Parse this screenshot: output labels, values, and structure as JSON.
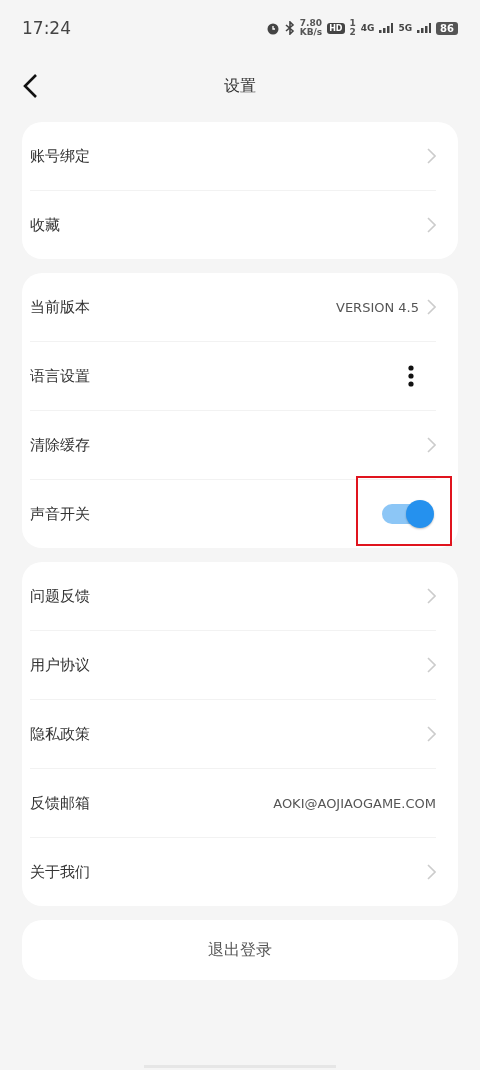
{
  "status_bar": {
    "time": "17:24",
    "speed": "7.80",
    "speed_unit": "KB/s",
    "hd": "HD",
    "sim": "1",
    "sim2": "2",
    "net1": "4G",
    "net2": "5G",
    "battery": "86"
  },
  "header": {
    "title": "设置"
  },
  "groups": [
    {
      "rows": [
        {
          "kind": "link",
          "label": "账号绑定"
        },
        {
          "kind": "link",
          "label": "收藏"
        }
      ]
    },
    {
      "rows": [
        {
          "kind": "link",
          "label": "当前版本",
          "value": "VERSION 4.5"
        },
        {
          "kind": "more",
          "label": "语言设置"
        },
        {
          "kind": "link",
          "label": "清除缓存"
        },
        {
          "kind": "switch",
          "label": "声音开关",
          "on": true,
          "highlighted": true
        }
      ]
    },
    {
      "rows": [
        {
          "kind": "link",
          "label": "问题反馈"
        },
        {
          "kind": "link",
          "label": "用户协议"
        },
        {
          "kind": "link",
          "label": "隐私政策"
        },
        {
          "kind": "info",
          "label": "反馈邮箱",
          "value": "AOKI@AOJIAOGAME.COM"
        },
        {
          "kind": "link",
          "label": "关于我们"
        }
      ]
    }
  ],
  "logout": {
    "label": "退出登录"
  }
}
